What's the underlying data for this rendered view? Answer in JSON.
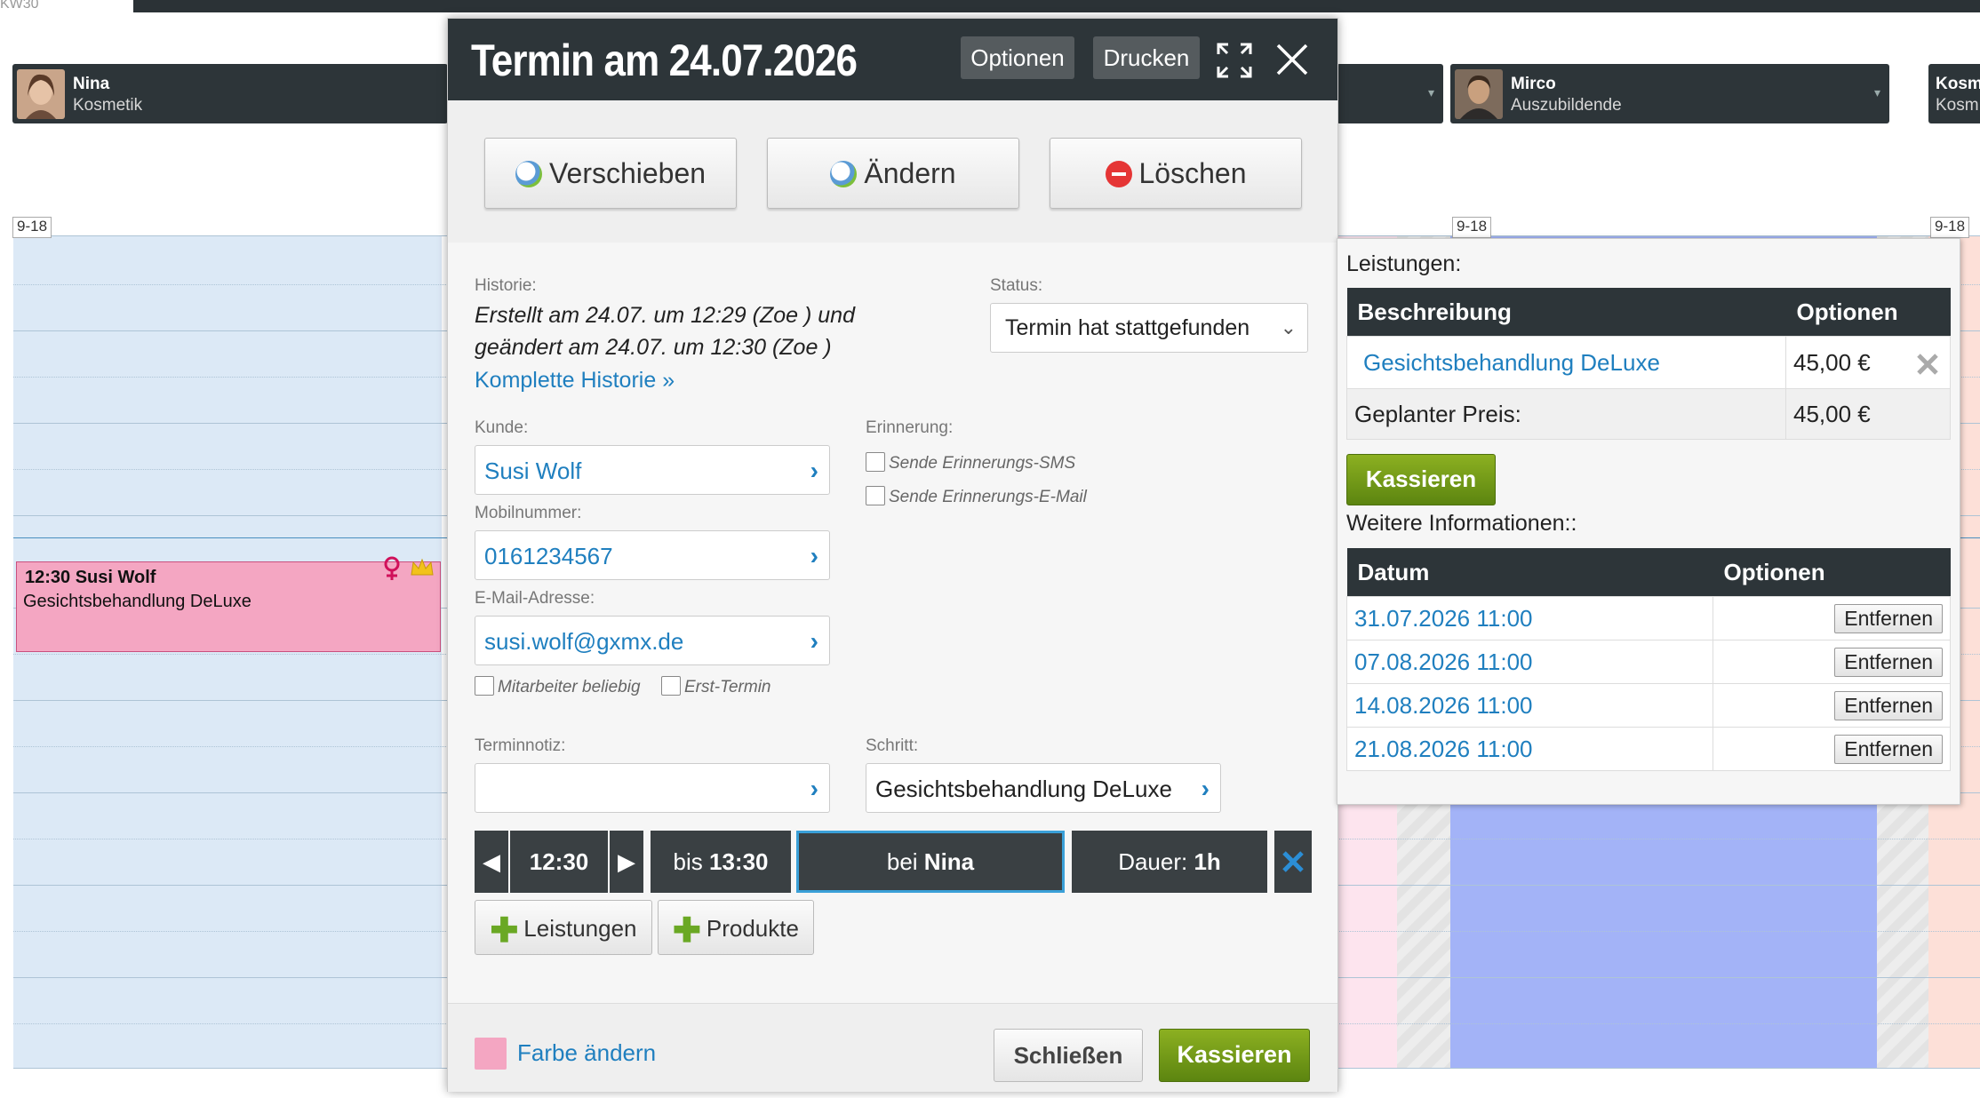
{
  "topbar": {
    "week_label": "KW30"
  },
  "staff": [
    {
      "name": "Nina",
      "role": "Kosmetik"
    },
    {
      "name": "Mirco",
      "role": "Auszubildende"
    },
    {
      "name": "Kosm",
      "role": "Kosm"
    }
  ],
  "calendar": {
    "hours_labels": [
      "9-18",
      "9-18",
      "9-18"
    ],
    "appointment": {
      "time_name": "12:30 Susi Wolf",
      "service": "Gesichtsbehandlung DeLuxe"
    }
  },
  "modal": {
    "title": "Termin am 24.07.2026",
    "header_buttons": {
      "options": "Optionen",
      "print": "Drucken"
    },
    "actions": {
      "move": "Verschieben",
      "change": "Ändern",
      "delete": "Löschen"
    },
    "history": {
      "label": "Historie:",
      "line1": "Erstellt am 24.07. um 12:29 (Zoe ) und",
      "line2": "geändert am 24.07. um 12:30 (Zoe )",
      "link": "Komplette Historie »"
    },
    "status": {
      "label": "Status:",
      "value": "Termin hat stattgefunden"
    },
    "customer": {
      "label": "Kunde:",
      "value": "Susi Wolf"
    },
    "mobile": {
      "label": "Mobilnummer:",
      "value": "0161234567"
    },
    "email": {
      "label": "E-Mail-Adresse:",
      "value": "susi.wolf@gxmx.de"
    },
    "checkboxes": {
      "any_employee": "Mitarbeiter beliebig",
      "first_appointment": "Erst-Termin"
    },
    "reminder": {
      "label": "Erinnerung:",
      "sms": "Sende Erinnerungs-SMS",
      "email": "Sende Erinnerungs-E-Mail"
    },
    "note": {
      "label": "Terminnotiz:",
      "value": ""
    },
    "step": {
      "label": "Schritt:",
      "value": "Gesichtsbehandlung DeLuxe"
    },
    "time": {
      "start": "12:30",
      "until_prefix": "bis",
      "until": "13:30",
      "with_prefix": "bei",
      "with": "Nina",
      "duration_prefix": "Dauer:",
      "duration": "1h"
    },
    "add": {
      "services": "Leistungen",
      "products": "Produkte"
    },
    "footer": {
      "color_link": "Farbe ändern",
      "close": "Schließen",
      "checkout": "Kassieren"
    }
  },
  "services_panel": {
    "label": "Leistungen:",
    "columns": [
      "Beschreibung",
      "Optionen"
    ],
    "rows": [
      {
        "description": "Gesichtsbehandlung DeLuxe",
        "price": "45,00 €"
      }
    ],
    "planned_label": "Geplanter Preis:",
    "planned_value": "45,00 €",
    "checkout": "Kassieren",
    "more_label": "Weitere Informationen::",
    "date_columns": [
      "Datum",
      "Optionen"
    ],
    "dates": [
      {
        "date": "31.07.2026 11:00",
        "action": "Entfernen"
      },
      {
        "date": "07.08.2026 11:00",
        "action": "Entfernen"
      },
      {
        "date": "14.08.2026 11:00",
        "action": "Entfernen"
      },
      {
        "date": "21.08.2026 11:00",
        "action": "Entfernen"
      }
    ]
  },
  "colors": {
    "header_dark": "#2d3539",
    "link_blue": "#1f7fbf",
    "green_button": "#6c9416",
    "appointment_pink": "#f4a6c2",
    "calendar_blue": "#dce9f6",
    "calendar_purple": "#a3b3f7"
  }
}
